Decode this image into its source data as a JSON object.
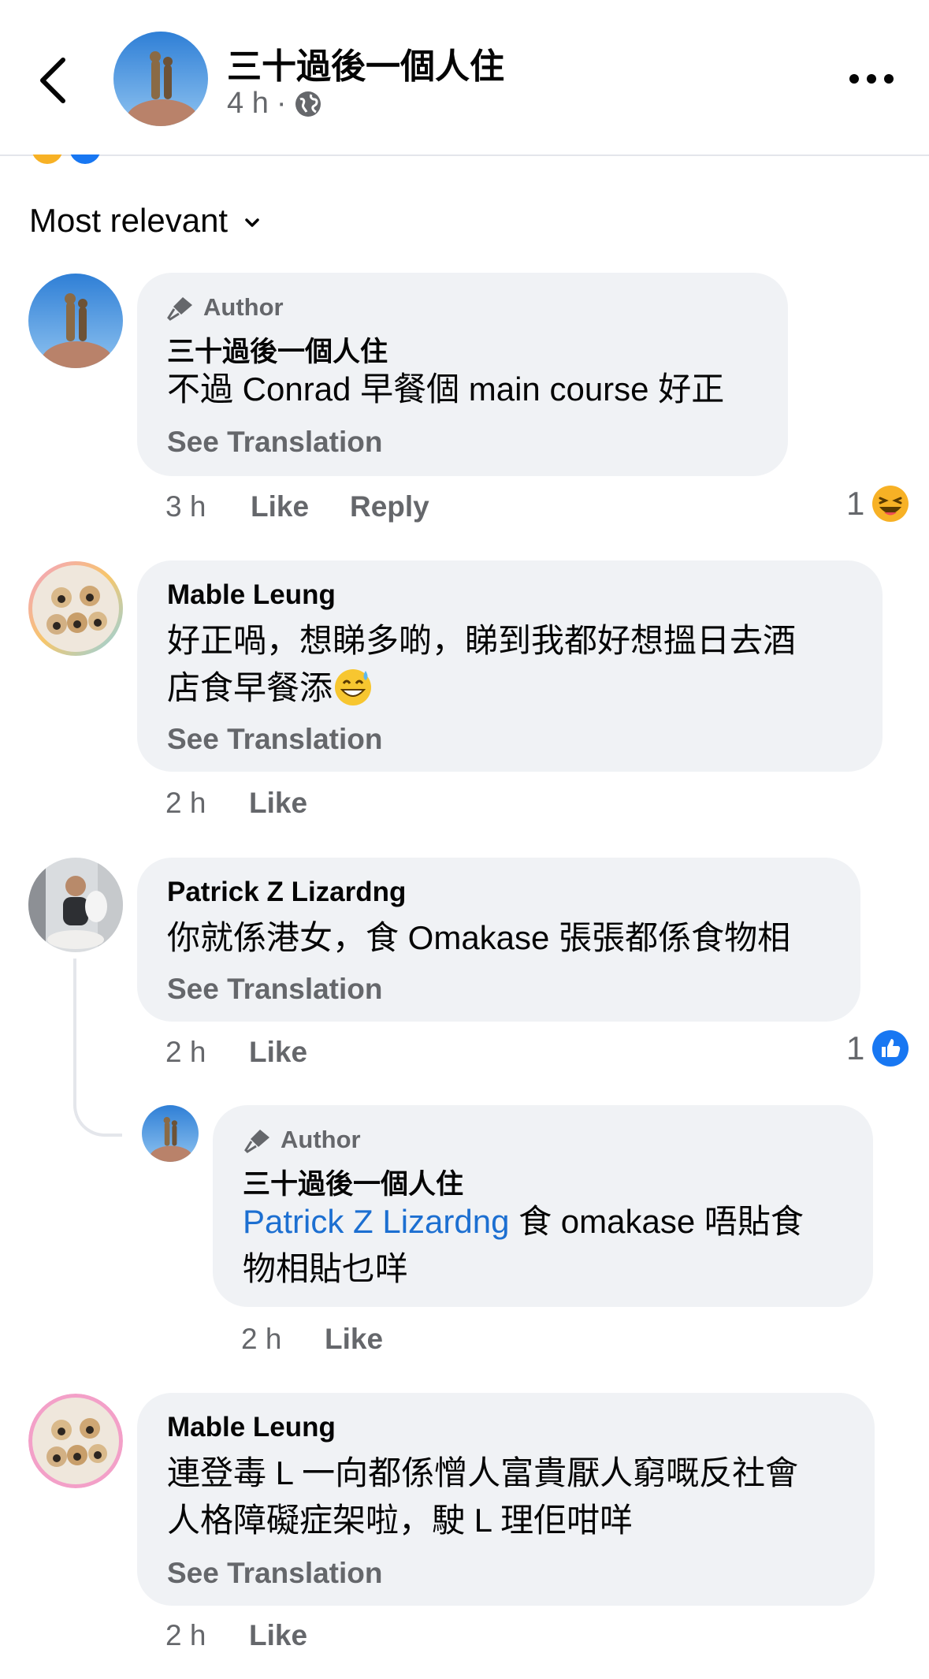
{
  "header": {
    "page_name": "三十過後一個人住",
    "time": "4 h",
    "dot": "·"
  },
  "sort": {
    "label": "Most relevant"
  },
  "comments": [
    {
      "author_badge": "Author",
      "name": "三十過後一個人住",
      "text": "不過 Conrad 早餐個 main course 好正",
      "see_translation": "See Translation",
      "time": "3 h",
      "like": "Like",
      "reply": "Reply",
      "reaction_count": "1",
      "reaction_icon": "laughing-emoji-icon"
    },
    {
      "name": "Mable Leung",
      "text_line1": "好正喎，想睇多啲，睇到我都好想搵日去酒",
      "text_line2": "店食早餐添",
      "see_translation": "See Translation",
      "time": "2 h",
      "like": "Like"
    },
    {
      "name": "Patrick Z Lizardng",
      "text": "你就係港女，食 Omakase 張張都係食物相",
      "see_translation": "See Translation",
      "time": "2 h",
      "like": "Like",
      "reaction_count": "1",
      "reaction_icon": "like-thumb-icon"
    },
    {
      "author_badge": "Author",
      "name": "三十過後一個人住",
      "mention": "Patrick Z Lizardng",
      "text_rest": " 食 omakase 唔貼食",
      "text_line2": "物相貼乜咩",
      "time": "2 h",
      "like": "Like"
    },
    {
      "name": "Mable Leung",
      "text_line1": "連登毒 L 一向都係憎人富貴厭人窮嘅反社會",
      "text_line2": "人格障礙症架啦，駛 L 理佢咁咩",
      "see_translation": "See Translation",
      "time": "2 h",
      "like": "Like"
    }
  ],
  "colors": {
    "bubble": "#f0f2f5",
    "secondary_text": "#65676b",
    "link": "#1c6fd1",
    "like_blue": "#1877f2"
  }
}
